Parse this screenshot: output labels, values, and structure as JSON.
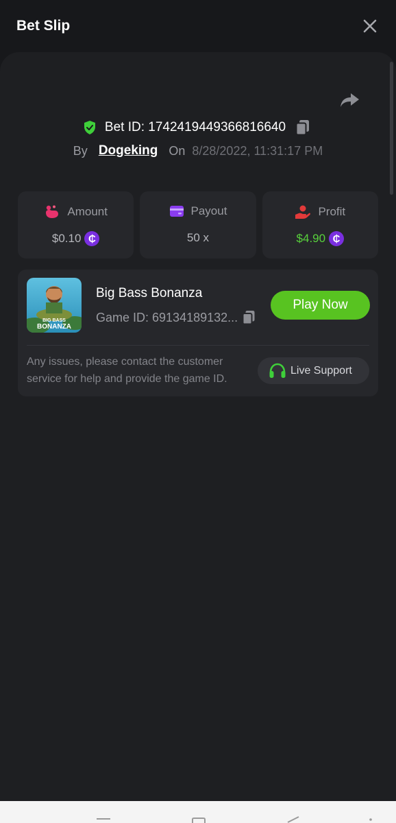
{
  "header": {
    "title": "Bet Slip"
  },
  "bet": {
    "bet_id": "Bet ID: 1742419449366816640",
    "by_label": "By",
    "username": "Dogeking",
    "on_label": "On",
    "date": "8/28/2022, 11:31:17 PM"
  },
  "stats": {
    "amount_label": "Amount",
    "amount_value": "$0.10",
    "payout_label": "Payout",
    "payout_value": "50 x",
    "profit_label": "Profit",
    "profit_value": "$4.90",
    "coin_symbol": "₵"
  },
  "game": {
    "name": "Big Bass Bonanza",
    "game_id": "Game ID: 69134189132...",
    "thumb_text_1": "BIG BASS",
    "thumb_text_2": "BONANZA",
    "play_label": "Play Now",
    "notice": "Any issues, please contact the customer service for help and provide the game ID.",
    "support_label": "Live Support"
  },
  "colors": {
    "accent_green": "#58c321",
    "profit_green": "#58d23c",
    "coin_purple": "#7a2fe0",
    "amount_icon": "#e8336d",
    "payout_icon": "#8a3cf0",
    "profit_icon": "#e23a3a"
  },
  "icons": [
    "close-icon",
    "share-icon",
    "shield-check-icon",
    "copy-icon",
    "amount-icon",
    "payout-card-icon",
    "profit-hand-icon",
    "coin-icon",
    "headset-icon"
  ]
}
